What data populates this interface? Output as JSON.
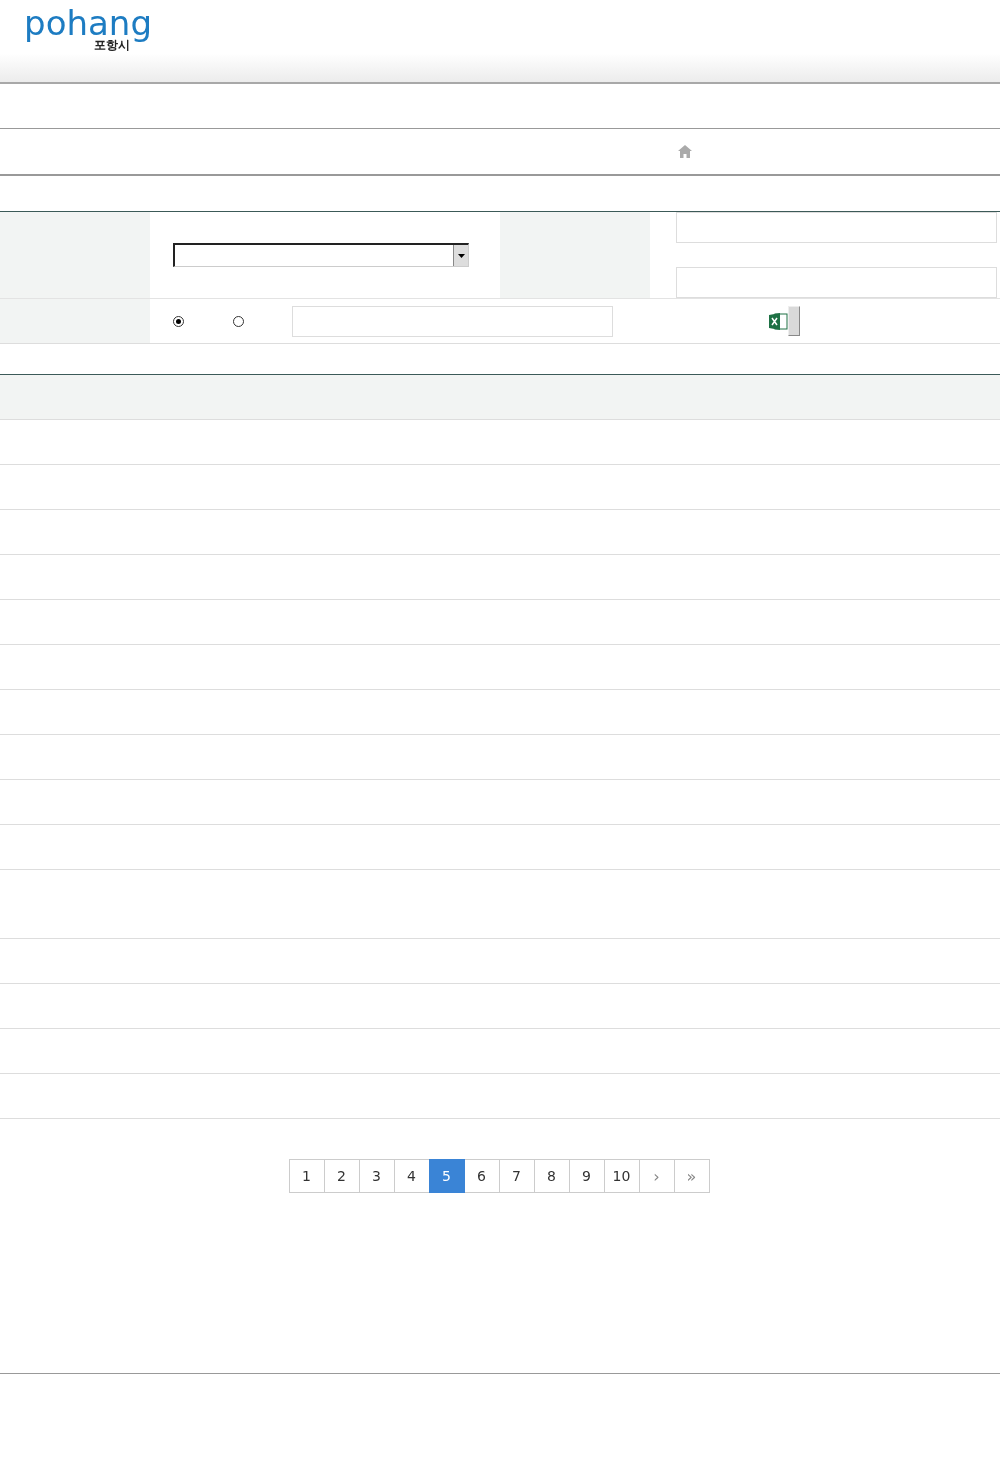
{
  "logo": {
    "wordmark": "pohang",
    "subtitle": "포항시"
  },
  "search_form": {
    "radios": [
      {
        "selected": true
      },
      {
        "selected": false
      }
    ]
  },
  "table": {
    "rows": [
      {
        "kind": "normal"
      },
      {
        "kind": "normal"
      },
      {
        "kind": "normal"
      },
      {
        "kind": "normal"
      },
      {
        "kind": "normal"
      },
      {
        "kind": "normal"
      },
      {
        "kind": "normal"
      },
      {
        "kind": "normal"
      },
      {
        "kind": "normal"
      },
      {
        "kind": "normal"
      },
      {
        "kind": "tall"
      },
      {
        "kind": "normal"
      },
      {
        "kind": "normal"
      },
      {
        "kind": "normal"
      },
      {
        "kind": "normal"
      }
    ]
  },
  "pagination": {
    "pages": [
      {
        "label": "1",
        "selected": false
      },
      {
        "label": "2",
        "selected": false
      },
      {
        "label": "3",
        "selected": false
      },
      {
        "label": "4",
        "selected": false
      },
      {
        "label": "5",
        "selected": true
      },
      {
        "label": "6",
        "selected": false
      },
      {
        "label": "7",
        "selected": false
      },
      {
        "label": "8",
        "selected": false
      },
      {
        "label": "9",
        "selected": false
      },
      {
        "label": "10",
        "selected": false
      }
    ],
    "next": "›",
    "last": "»"
  }
}
